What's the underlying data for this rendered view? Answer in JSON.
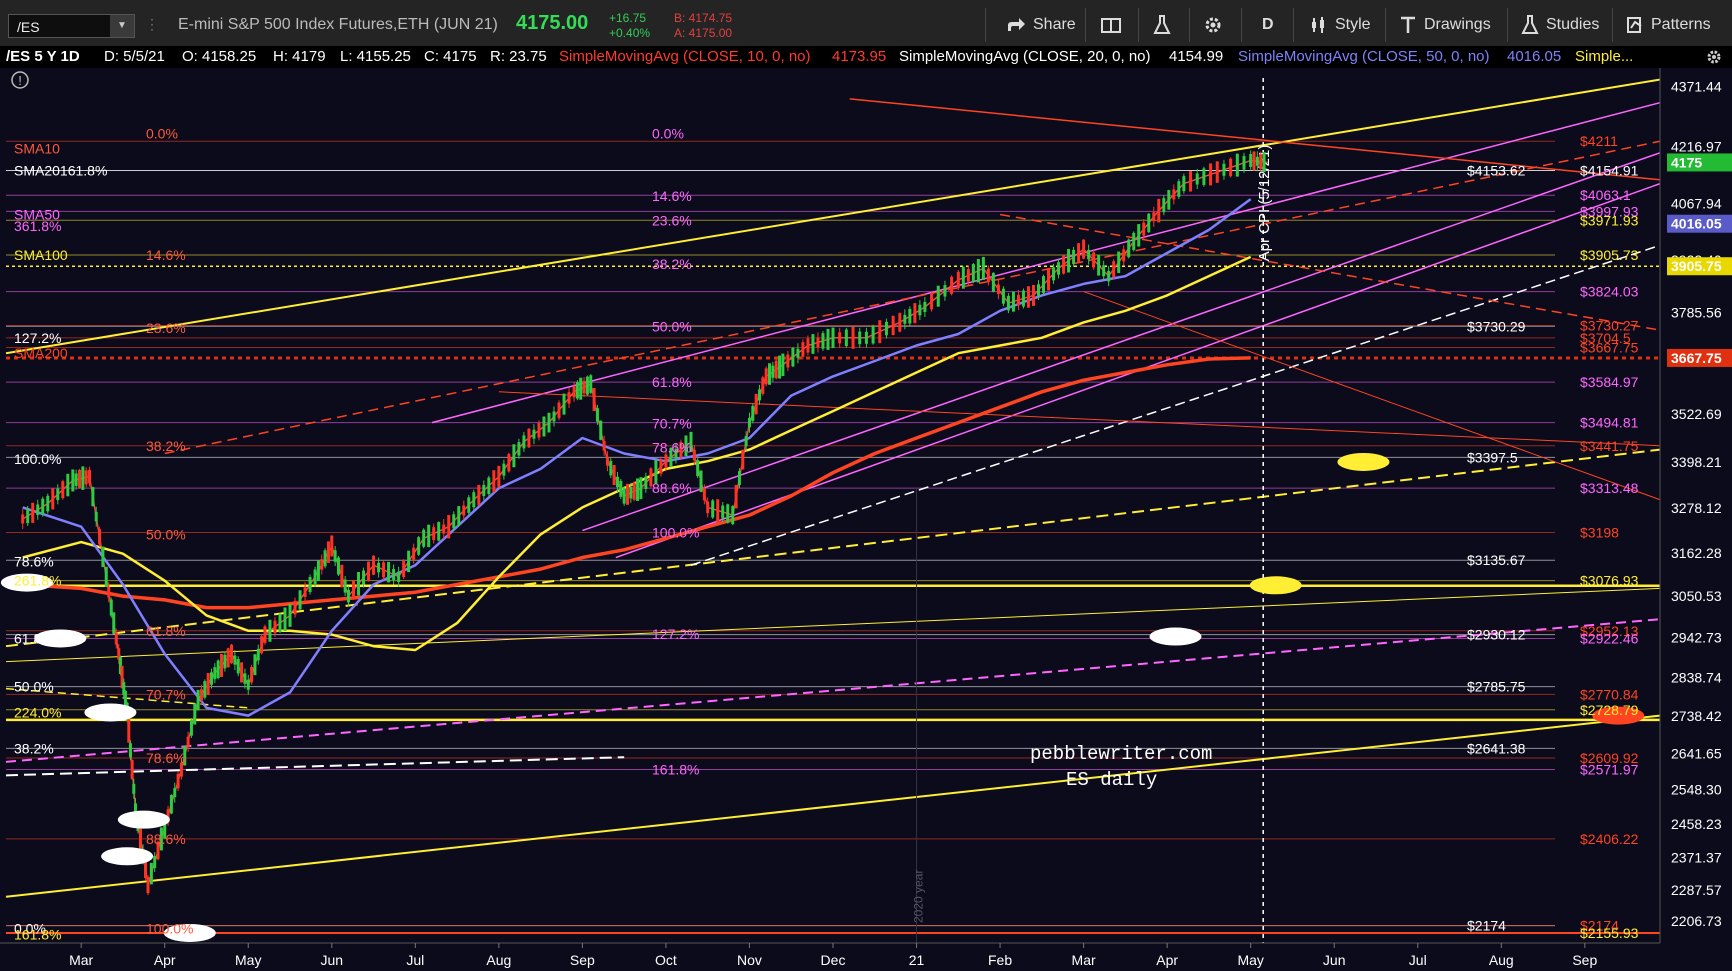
{
  "toolbar": {
    "symbol": "/ES",
    "description": "E-mini S&P 500 Index Futures,ETH (JUN 21)",
    "last": "4175.00",
    "change": "+16.75",
    "change_pct": "+0.40%",
    "bid": "B: 4174.75",
    "ask": "A: 4175.00",
    "share": "Share",
    "period": "D",
    "style": "Style",
    "drawings": "Drawings",
    "studies": "Studies",
    "patterns": "Patterns"
  },
  "infobar": {
    "title": "/ES 5 Y 1D",
    "date": "D: 5/5/21",
    "open": "O: 4158.25",
    "high": "H: 4179",
    "low": "L: 4155.25",
    "close": "C: 4175",
    "range": "R: 23.75",
    "sma10": "SimpleMovingAvg (CLOSE, 10, 0, no)",
    "sma10_val": "4173.95",
    "sma20": "SimpleMovingAvg (CLOSE, 20, 0, no)",
    "sma20_val": "4154.99",
    "sma50": "SimpleMovingAvg (CLOSE, 50, 0, no)",
    "sma50_val": "4016.05",
    "more": "Simple..."
  },
  "chart_data": {
    "type": "line",
    "title": "",
    "xlabel": "",
    "ylabel": "",
    "yticks": [
      4371.44,
      4216.97,
      4067.94,
      3922.4,
      3785.56,
      3522.69,
      3398.21,
      3278.12,
      3162.28,
      3050.53,
      2942.73,
      2838.74,
      2738.42,
      2641.65,
      2548.3,
      2458.23,
      2371.37,
      2287.57,
      2206.73
    ],
    "ylim": [
      2150,
      4420
    ],
    "x_month_labels": [
      "Mar",
      "Apr",
      "May",
      "Jun",
      "Jul",
      "Aug",
      "Sep",
      "Oct",
      "Nov",
      "Dec",
      "21",
      "Feb",
      "Mar",
      "Apr",
      "May",
      "Jun",
      "Jul",
      "Aug",
      "Sep"
    ],
    "x_month_index": [
      2,
      3,
      4,
      5,
      6,
      7,
      8,
      9,
      10,
      11,
      12,
      13,
      14,
      15,
      16,
      17,
      18,
      19,
      20
    ],
    "x_range": [
      1.1,
      20.9
    ],
    "price_series": {
      "name": "/ES",
      "x": [
        1.3,
        1.6,
        1.9,
        2.1,
        2.3,
        2.45,
        2.55,
        2.65,
        2.8,
        3.0,
        3.2,
        3.4,
        3.6,
        3.8,
        4.0,
        4.2,
        4.5,
        4.8,
        5.0,
        5.2,
        5.5,
        5.8,
        6.1,
        6.4,
        6.7,
        7.0,
        7.3,
        7.6,
        7.9,
        8.1,
        8.3,
        8.5,
        8.7,
        9.0,
        9.3,
        9.5,
        9.8,
        10.0,
        10.2,
        10.4,
        10.7,
        11.0,
        11.4,
        11.8,
        12.1,
        12.5,
        12.8,
        13.1,
        13.4,
        13.7,
        14.0,
        14.3,
        14.6,
        14.9,
        15.2,
        15.6,
        16.0,
        16.2
      ],
      "close": [
        3250,
        3290,
        3350,
        3360,
        3100,
        2900,
        2750,
        2500,
        2300,
        2450,
        2600,
        2780,
        2850,
        2900,
        2820,
        2950,
        3000,
        3100,
        3180,
        3050,
        3130,
        3100,
        3200,
        3230,
        3300,
        3360,
        3450,
        3500,
        3580,
        3600,
        3400,
        3310,
        3330,
        3400,
        3450,
        3280,
        3260,
        3500,
        3620,
        3650,
        3700,
        3720,
        3720,
        3760,
        3800,
        3870,
        3900,
        3810,
        3830,
        3900,
        3950,
        3880,
        3970,
        4050,
        4120,
        4150,
        4180,
        4175
      ]
    },
    "series": [
      {
        "name": "SimpleMovingAvg (CLOSE, 10, 0, no)",
        "color": "#ff3b30"
      },
      {
        "name": "SimpleMovingAvg (CLOSE, 20, 0, no)",
        "color": "#ffffff"
      },
      {
        "name": "SimpleMovingAvg (CLOSE, 50, 0, no)",
        "color": "#8080ff"
      },
      {
        "name": "SMA100",
        "color": "#ffee33"
      },
      {
        "name": "SMA200",
        "color": "#ff4422"
      }
    ],
    "sma50_path": {
      "x": [
        1.3,
        2.0,
        2.5,
        3.0,
        3.5,
        4.0,
        4.5,
        5.0,
        5.5,
        6.0,
        6.5,
        7.0,
        7.5,
        8.0,
        8.5,
        9.0,
        9.5,
        10.0,
        10.5,
        11.0,
        11.5,
        12.0,
        12.5,
        13.0,
        13.5,
        14.0,
        14.5,
        15.0,
        15.5,
        16.0
      ],
      "y": [
        3280,
        3230,
        3080,
        2900,
        2760,
        2740,
        2800,
        2960,
        3080,
        3130,
        3230,
        3330,
        3380,
        3460,
        3420,
        3400,
        3420,
        3460,
        3570,
        3620,
        3660,
        3700,
        3730,
        3790,
        3830,
        3860,
        3880,
        3940,
        4000,
        4080
      ]
    },
    "sma100_path": {
      "x": [
        1.3,
        2.0,
        2.5,
        3.0,
        3.5,
        4.0,
        4.5,
        5.0,
        5.5,
        6.0,
        6.5,
        7.0,
        7.5,
        8.0,
        8.5,
        9.0,
        9.5,
        10.0,
        10.5,
        11.0,
        11.5,
        12.0,
        12.5,
        13.0,
        13.5,
        14.0,
        14.5,
        15.0,
        15.5,
        16.0
      ],
      "y": [
        3150,
        3190,
        3160,
        3090,
        3000,
        2960,
        2960,
        2950,
        2920,
        2910,
        2980,
        3100,
        3210,
        3280,
        3330,
        3380,
        3400,
        3430,
        3480,
        3530,
        3580,
        3630,
        3680,
        3700,
        3720,
        3760,
        3790,
        3830,
        3880,
        3930
      ]
    },
    "sma200_path": {
      "x": [
        1.3,
        2.0,
        2.5,
        3.0,
        3.5,
        4.0,
        4.5,
        5.0,
        5.5,
        6.0,
        6.5,
        7.0,
        7.5,
        8.0,
        8.5,
        9.0,
        9.5,
        10.0,
        10.5,
        11.0,
        11.5,
        12.0,
        12.5,
        13.0,
        13.5,
        14.0,
        14.5,
        15.0,
        15.5,
        16.0
      ],
      "y": [
        3080,
        3070,
        3050,
        3040,
        3020,
        3020,
        3030,
        3040,
        3050,
        3060,
        3080,
        3100,
        3120,
        3150,
        3170,
        3200,
        3230,
        3260,
        3310,
        3370,
        3420,
        3460,
        3500,
        3540,
        3580,
        3610,
        3630,
        3650,
        3665,
        3668
      ]
    },
    "price_tags": [
      {
        "label": "4175",
        "value": 4175,
        "color": "#22bb33"
      },
      {
        "label": "4016.05",
        "value": 4016.05,
        "color": "#5a5ac8"
      },
      {
        "label": "3905.75",
        "value": 3905.75,
        "color": "#e8d800"
      },
      {
        "label": "3667.75",
        "value": 3667.75,
        "color": "#e03010"
      }
    ],
    "left_fib_labels": [
      {
        "label": "SMA10",
        "value": 4211,
        "color": "#ff5a3a"
      },
      {
        "label": "SMA20161.8%",
        "value": 4154,
        "color": "#ffffff"
      },
      {
        "label": "SMA50",
        "value": 4040,
        "color": "#ff66ff"
      },
      {
        "label": "361.8%",
        "value": 4010,
        "color": "#ff66ff"
      },
      {
        "label": "SMA100",
        "value": 3935,
        "color": "#ffee33"
      },
      {
        "label": "127.2%",
        "value": 3720,
        "color": "#ffffff"
      },
      {
        "label": "SMA200",
        "value": 3680,
        "color": "#ff4422"
      },
      {
        "label": "100.0%",
        "value": 3405,
        "color": "#ffffff"
      },
      {
        "label": "78.6%",
        "value": 3140,
        "color": "#ffffff"
      },
      {
        "label": "261.8%",
        "value": 3090,
        "color": "#ffee33"
      },
      {
        "label": "61.8%",
        "value": 2940,
        "color": "#ffffff"
      },
      {
        "label": "50.0%",
        "value": 2815,
        "color": "#ffffff"
      },
      {
        "label": "224.0%",
        "value": 2748,
        "color": "#ffee33"
      },
      {
        "label": "38.2%",
        "value": 2655,
        "color": "#ffffff"
      },
      {
        "label": "0.0%",
        "value": 2188,
        "color": "#ffffff"
      },
      {
        "label": "161.8%",
        "value": 2172,
        "color": "#ffee33"
      }
    ],
    "fib_set_red": [
      {
        "label": "0.0%",
        "value": 4250
      },
      {
        "label": "14.6%",
        "value": 3935
      },
      {
        "label": "23.6%",
        "value": 3745
      },
      {
        "label": "38.2%",
        "value": 3440
      },
      {
        "label": "50.0%",
        "value": 3210
      },
      {
        "label": "61.8%",
        "value": 2960
      },
      {
        "label": "70.7%",
        "value": 2795
      },
      {
        "label": "78.6%",
        "value": 2630
      },
      {
        "label": "88.6%",
        "value": 2420
      },
      {
        "label": "100.0%",
        "value": 2188
      }
    ],
    "fib_set_pink": [
      {
        "label": "0.0%",
        "value": 4250
      },
      {
        "label": "14.6%",
        "value": 4088
      },
      {
        "label": "23.6%",
        "value": 4025
      },
      {
        "label": "38.2%",
        "value": 3912
      },
      {
        "label": "50.0%",
        "value": 3750
      },
      {
        "label": "61.8%",
        "value": 3605
      },
      {
        "label": "70.7%",
        "value": 3498
      },
      {
        "label": "78.6%",
        "value": 3435
      },
      {
        "label": "88.6%",
        "value": 3330
      },
      {
        "label": "100.0%",
        "value": 3215
      },
      {
        "label": "127.2%",
        "value": 2952
      },
      {
        "label": "161.8%",
        "value": 2600
      }
    ],
    "right_levels": [
      {
        "label": "$4211",
        "value": 4230,
        "color": "#ff4422"
      },
      {
        "label": "$4153.62",
        "value": 4154,
        "color": "#ffffff",
        "col": 1
      },
      {
        "label": "$4154.91",
        "value": 4154,
        "color": "#ffffff"
      },
      {
        "label": "$4063.1",
        "value": 4090,
        "color": "#ff66ff"
      },
      {
        "label": "$3997.93",
        "value": 4048,
        "color": "#ff66ff"
      },
      {
        "label": "$3971.93",
        "value": 4025,
        "color": "#ffee33"
      },
      {
        "label": "$3905.73",
        "value": 3935,
        "color": "#ffee33"
      },
      {
        "label": "$3824.03",
        "value": 3840,
        "color": "#ff66ff"
      },
      {
        "label": "$3730.29",
        "value": 3750,
        "color": "#ffffff",
        "col": 1
      },
      {
        "label": "$3730.27",
        "value": 3752,
        "color": "#ff4422"
      },
      {
        "label": "$3704.5",
        "value": 3720,
        "color": "#ff4422"
      },
      {
        "label": "$3667.75",
        "value": 3695,
        "color": "#ff4422"
      },
      {
        "label": "$3584.97",
        "value": 3605,
        "color": "#ff66ff"
      },
      {
        "label": "$3494.81",
        "value": 3500,
        "color": "#ff66ff"
      },
      {
        "label": "$3441.75",
        "value": 3440,
        "color": "#ff4422"
      },
      {
        "label": "$3397.5",
        "value": 3410,
        "color": "#ffffff",
        "col": 1
      },
      {
        "label": "$3313.48",
        "value": 3330,
        "color": "#ff66ff"
      },
      {
        "label": "$3198",
        "value": 3215,
        "color": "#ff4422"
      },
      {
        "label": "$3135.67",
        "value": 3143,
        "color": "#ffffff",
        "col": 1
      },
      {
        "label": "$3076.93",
        "value": 3090,
        "color": "#ffee33"
      },
      {
        "label": "$2952.13",
        "value": 2960,
        "color": "#ff4422"
      },
      {
        "label": "$2930.12",
        "value": 2950,
        "color": "#ffffff",
        "col": 1
      },
      {
        "label": "$2922.46",
        "value": 2940,
        "color": "#ff66ff"
      },
      {
        "label": "$2785.75",
        "value": 2815,
        "color": "#ffffff",
        "col": 1
      },
      {
        "label": "$2770.84",
        "value": 2795,
        "color": "#ff4422"
      },
      {
        "label": "$2728.79",
        "value": 2755,
        "color": "#ffee33"
      },
      {
        "label": "$2641.38",
        "value": 2655,
        "color": "#ffffff",
        "col": 1
      },
      {
        "label": "$2609.92",
        "value": 2630,
        "color": "#ff4422"
      },
      {
        "label": "$2571.97",
        "value": 2600,
        "color": "#ff66ff"
      },
      {
        "label": "$2406.22",
        "value": 2420,
        "color": "#ff4422"
      },
      {
        "label": "$2174",
        "value": 2195,
        "color": "#ffffff",
        "col": 1
      },
      {
        "label": "$2174",
        "value": 2195,
        "color": "#ff4422"
      },
      {
        "label": "$2155.93",
        "value": 2176,
        "color": "#ffee33"
      }
    ],
    "annotations": {
      "watermark_line1": "pebblewriter.com",
      "watermark_line2": "ES daily",
      "vertical_marker": "Apr CPI (5/12/21)",
      "year_marker": "2020 year"
    },
    "grid": false,
    "legend": "top"
  }
}
